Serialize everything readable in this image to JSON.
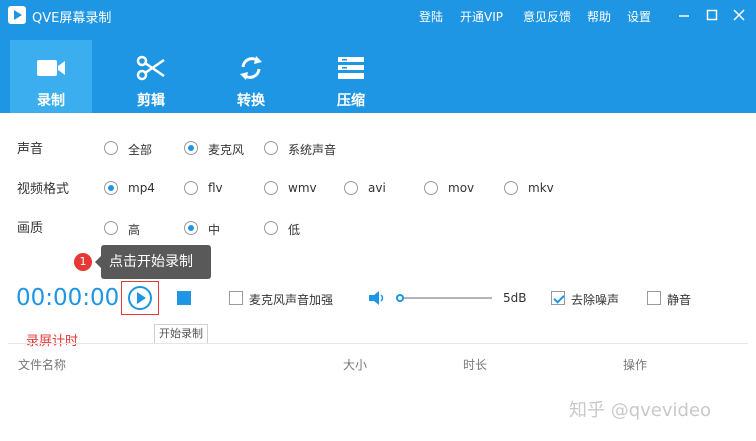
{
  "app": {
    "title": "QVE屏幕录制"
  },
  "menu": [
    "登陆",
    "开通VIP",
    "意见反馈",
    "帮助",
    "设置"
  ],
  "window_controls": [
    "minimize",
    "maximize",
    "close"
  ],
  "tabs": [
    {
      "label": "录制",
      "icon": "video-camera-icon",
      "active": true
    },
    {
      "label": "剪辑",
      "icon": "scissors-icon",
      "active": false
    },
    {
      "label": "转换",
      "icon": "refresh-arrows-icon",
      "active": false
    },
    {
      "label": "压缩",
      "icon": "compress-stack-icon",
      "active": false
    }
  ],
  "settings": {
    "audio": {
      "label": "声音",
      "options": [
        "全部",
        "麦克风",
        "系统声音"
      ],
      "selected": "麦克风"
    },
    "format": {
      "label": "视频格式",
      "options": [
        "mp4",
        "flv",
        "wmv",
        "avi",
        "mov",
        "mkv"
      ],
      "selected": "mp4"
    },
    "quality": {
      "label": "画质",
      "options": [
        "高",
        "中",
        "低"
      ],
      "selected": "中"
    }
  },
  "tip": {
    "badge": "1",
    "text": "点击开始录制"
  },
  "controls": {
    "timer": "00:00:00",
    "mic_boost_label": "麦克风声音加强",
    "mic_boost_checked": false,
    "volume_value": "5dB",
    "volume_level": 0.04,
    "denoise_label": "去除噪声",
    "denoise_checked": true,
    "mute_label": "静音",
    "mute_checked": false
  },
  "tooltip": "开始录制",
  "timer_caption": "录屏计时",
  "table": {
    "columns": [
      "文件名称",
      "大小",
      "时长",
      "操作"
    ]
  },
  "watermark": "知乎 @qvevideo",
  "colors": {
    "accent": "#1e96e4",
    "active_tab": "#3aaeef",
    "highlight": "#e53935"
  }
}
